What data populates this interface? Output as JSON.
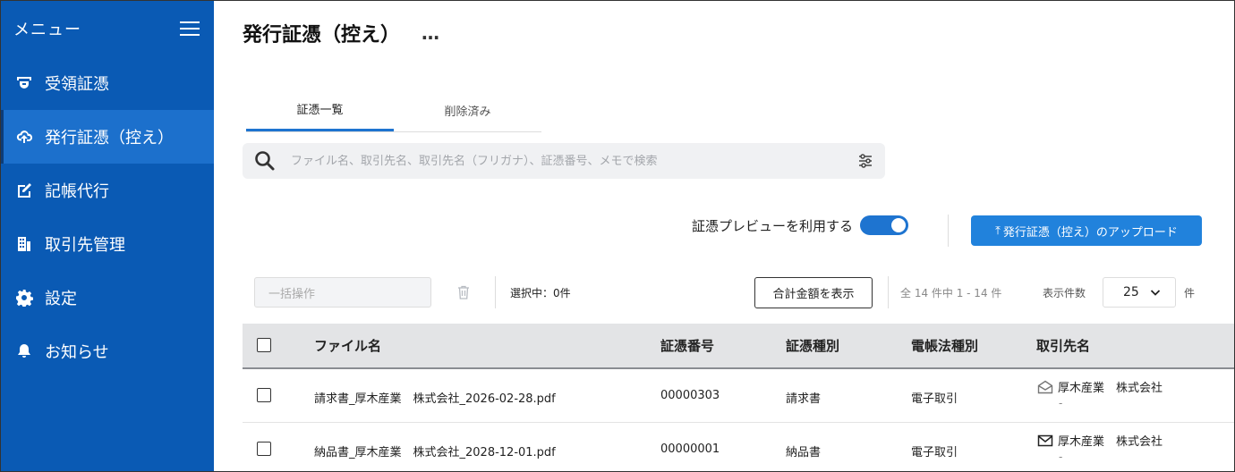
{
  "sidebar": {
    "menu_title": "メニュー",
    "items": [
      {
        "label": "受領証憑",
        "icon": "receive-icon"
      },
      {
        "label": "発行証憑（控え）",
        "icon": "upload-cloud-icon",
        "active": true
      },
      {
        "label": "記帳代行",
        "icon": "edit-note-icon"
      },
      {
        "label": "取引先管理",
        "icon": "building-icon"
      },
      {
        "label": "設定",
        "icon": "gear-icon"
      },
      {
        "label": "お知らせ",
        "icon": "bell-icon"
      }
    ]
  },
  "header": {
    "title": "発行証憑（控え）",
    "more": "…"
  },
  "tabs": [
    {
      "label": "証憑一覧",
      "active": true
    },
    {
      "label": "削除済み",
      "active": false
    }
  ],
  "search": {
    "placeholder": "ファイル名、取引先名、取引先名（フリガナ）、証憑番号、メモで検索",
    "value": ""
  },
  "preview": {
    "label": "証憑プレビューを利用する",
    "enabled": true
  },
  "upload_button": {
    "arrow": "⤒",
    "label": "発行証憑（控え）のアップロード"
  },
  "toolbar": {
    "bulk_placeholder": "一括操作",
    "selected_count": "選択中：0件",
    "sum_button": "合計金額を表示",
    "range_text": "全 14 件中 1 - 14 件",
    "per_page_label": "表示件数",
    "per_page_value": "25",
    "per_page_unit": "件"
  },
  "table": {
    "headers": {
      "file": "ファイル名",
      "number": "証憑番号",
      "type": "証憑種別",
      "law": "電帳法種別",
      "partner": "取引先名"
    },
    "rows": [
      {
        "file": "請求書_厚木産業　株式会社_2026-02-28.pdf",
        "number": "00000303",
        "type": "請求書",
        "law": "電子取引",
        "partner": "厚木産業　株式会社",
        "partner_sub": "-",
        "partner_icon": "envelope-open-icon"
      },
      {
        "file": "納品書_厚木産業　株式会社_2028-12-01.pdf",
        "number": "00000001",
        "type": "納品書",
        "law": "電子取引",
        "partner": "厚木産業　株式会社",
        "partner_sub": "-",
        "partner_icon": "envelope-icon"
      }
    ]
  },
  "colors": {
    "sidebar_bg": "#0a5ab4",
    "sidebar_active": "#1c70cc",
    "accent": "#2182dc"
  }
}
